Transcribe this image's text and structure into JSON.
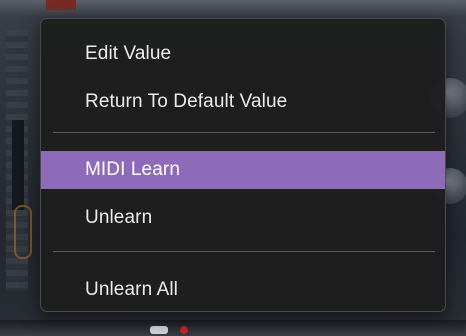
{
  "context_menu": {
    "items": [
      {
        "label": "Edit Value",
        "highlighted": false
      },
      {
        "label": "Return To Default Value",
        "highlighted": false
      },
      {
        "label": "MIDI Learn",
        "highlighted": true
      },
      {
        "label": "Unlearn",
        "highlighted": false
      },
      {
        "label": "Unlearn All",
        "highlighted": false
      }
    ]
  },
  "colors": {
    "menu_background": "#1e1e1e",
    "highlight": "#8e6bb8",
    "text": "#ececec",
    "separator": "#5a5a5a"
  }
}
